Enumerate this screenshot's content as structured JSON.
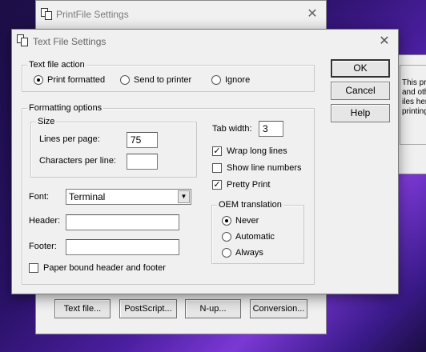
{
  "background_window": {
    "title": "PrintFile Settings",
    "close_symbol": "✕",
    "buttons": [
      "Text file...",
      "PostScript...",
      "N-up...",
      "Conversion..."
    ]
  },
  "right_window": {
    "text_lines": [
      "This pro",
      "and othe",
      "iles here",
      "printing."
    ]
  },
  "dialog": {
    "title": "Text File Settings",
    "close_symbol": "✕",
    "text_file_action": {
      "legend": "Text file action",
      "options": [
        {
          "label": "Print formatted",
          "selected": true
        },
        {
          "label": "Send to printer",
          "selected": false
        },
        {
          "label": "Ignore",
          "selected": false
        }
      ]
    },
    "formatting": {
      "legend": "Formatting options",
      "size": {
        "legend": "Size",
        "lines_per_page_label": "Lines per page:",
        "lines_per_page_value": "75",
        "chars_per_line_label": "Characters per line:",
        "chars_per_line_value": ""
      },
      "font_label": "Font:",
      "font_value": "Terminal",
      "header_label": "Header:",
      "header_value": "",
      "footer_label": "Footer:",
      "footer_value": "",
      "paper_bound_label": "Paper bound header and footer",
      "paper_bound_checked": false,
      "tab_width_label": "Tab width:",
      "tab_width_value": "3",
      "wrap_long_lines": {
        "label": "Wrap long lines",
        "checked": true
      },
      "show_line_numbers": {
        "label": "Show line numbers",
        "checked": false
      },
      "pretty_print": {
        "label": "Pretty Print",
        "checked": true
      },
      "oem_translation": {
        "legend": "OEM translation",
        "options": [
          {
            "label": "Never",
            "selected": true
          },
          {
            "label": "Automatic",
            "selected": false
          },
          {
            "label": "Always",
            "selected": false
          }
        ]
      }
    },
    "buttons": {
      "ok": "OK",
      "cancel": "Cancel",
      "help": "Help"
    }
  }
}
